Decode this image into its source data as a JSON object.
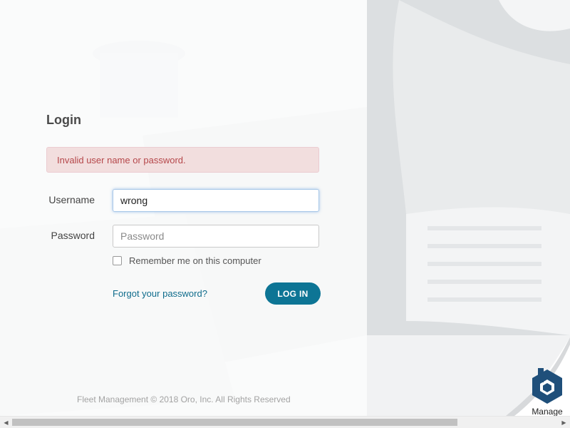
{
  "login": {
    "title": "Login",
    "error": "Invalid user name or password.",
    "username_label": "Username",
    "username_value": "wrong",
    "password_label": "Password",
    "password_placeholder": "Password",
    "remember_label": "Remember me on this computer",
    "forgot_label": "Forgot your password?",
    "submit_label": "LOG IN"
  },
  "footer": {
    "text": "Fleet Management © 2018 Oro, Inc. All Rights Reserved"
  },
  "brand": {
    "label": "Manage",
    "icon": "hexagon-logo-icon",
    "color": "#1f4f7a"
  },
  "colors": {
    "accent": "#0d7595",
    "error_bg": "#f2dede",
    "error_text": "#b5474a"
  }
}
